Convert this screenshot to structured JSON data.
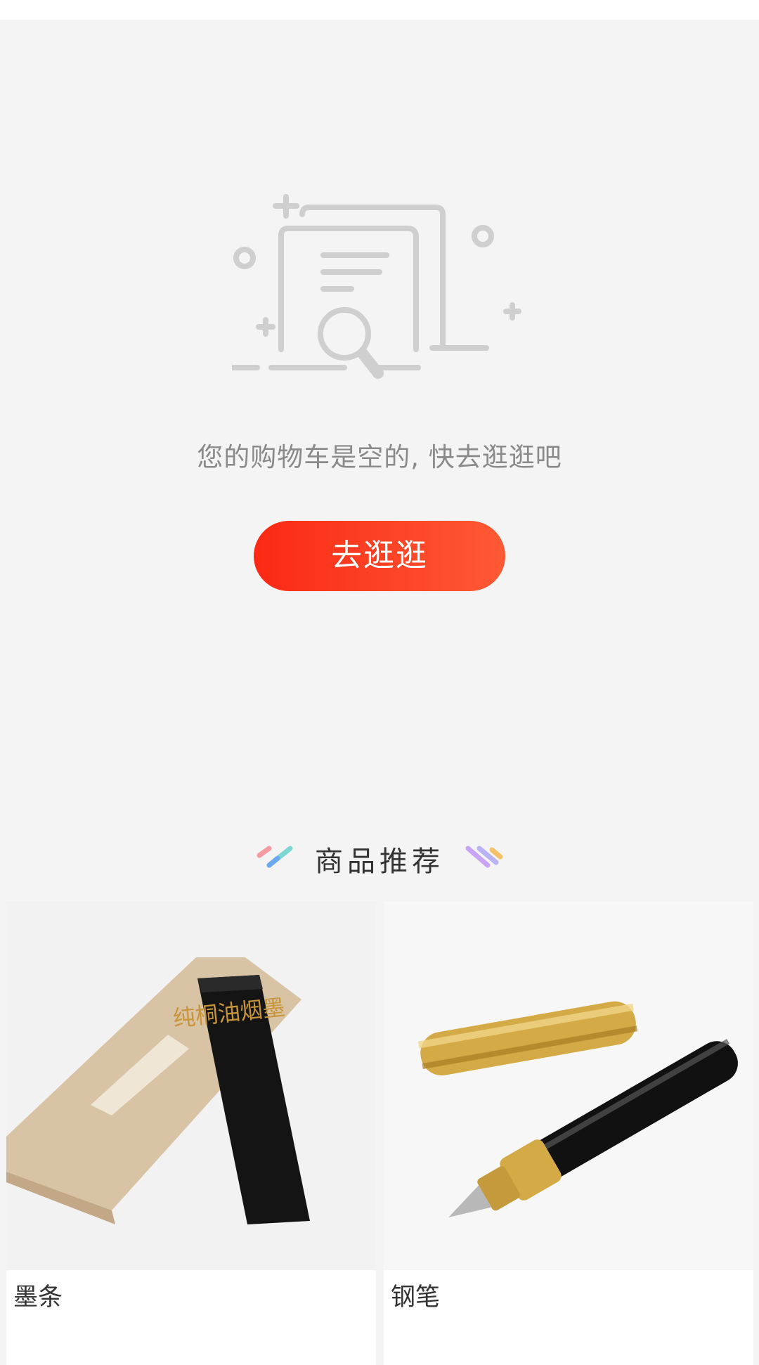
{
  "empty_cart": {
    "message": "您的购物车是空的, 快去逛逛吧",
    "button_label": "去逛逛",
    "illustration_icon": "empty-document-search-icon"
  },
  "recommend": {
    "title": "商品推荐",
    "products": [
      {
        "name": "墨条",
        "image_icon": "ink-stick-image",
        "image_text": "纯桐油烟墨"
      },
      {
        "name": "钢笔",
        "image_icon": "fountain-pen-image"
      }
    ]
  },
  "colors": {
    "accent_start": "#fb2914",
    "accent_end": "#fe5935",
    "background": "#f4f4f4",
    "illustration_gray": "#cfcfcf"
  }
}
